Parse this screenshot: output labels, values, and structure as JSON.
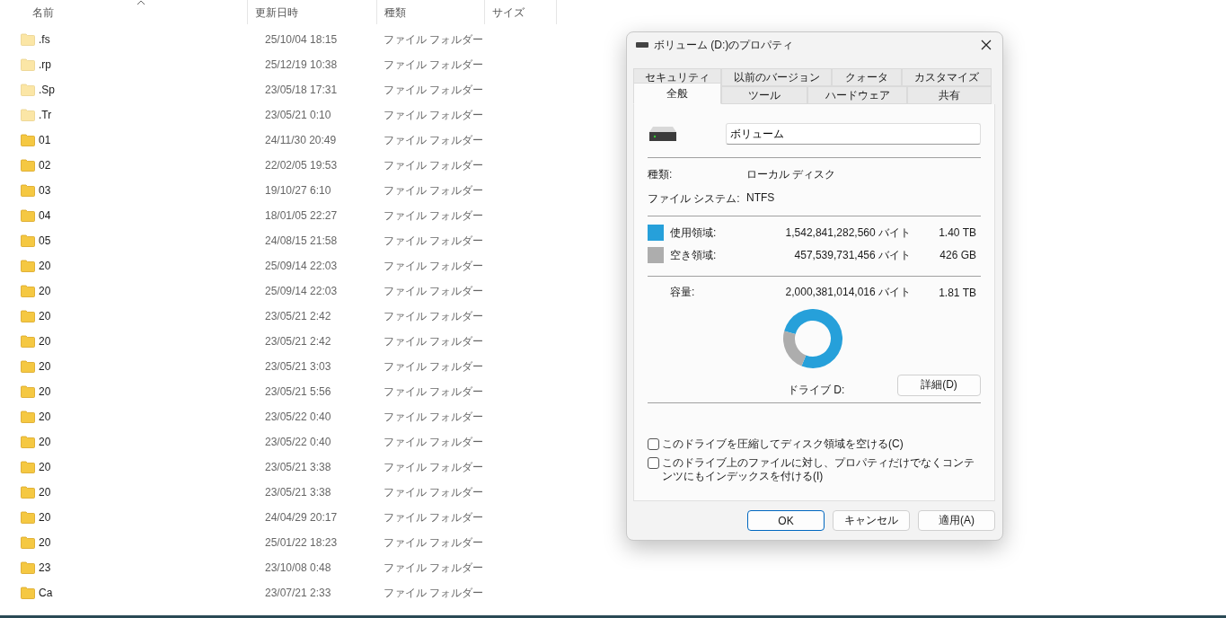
{
  "columns": [
    {
      "label": "名前",
      "sorted": true
    },
    {
      "label": "更新日時",
      "sorted": false
    },
    {
      "label": "種類",
      "sorted": false
    },
    {
      "label": "サイズ",
      "sorted": false
    }
  ],
  "files": [
    {
      "name": ".fs",
      "date": "25/10/04 18:15",
      "type": "ファイル フォルダー",
      "hidden": true
    },
    {
      "name": ".rp",
      "date": "25/12/19 10:38",
      "type": "ファイル フォルダー",
      "hidden": true
    },
    {
      "name": ".Sp",
      "date": "23/05/18 17:31",
      "type": "ファイル フォルダー",
      "hidden": true
    },
    {
      "name": ".Tr",
      "date": "23/05/21 0:10",
      "type": "ファイル フォルダー",
      "hidden": true
    },
    {
      "name": "01",
      "date": "24/11/30 20:49",
      "type": "ファイル フォルダー",
      "hidden": false
    },
    {
      "name": "02",
      "date": "22/02/05 19:53",
      "type": "ファイル フォルダー",
      "hidden": false
    },
    {
      "name": "03",
      "date": "19/10/27 6:10",
      "type": "ファイル フォルダー",
      "hidden": false
    },
    {
      "name": "04",
      "date": "18/01/05 22:27",
      "type": "ファイル フォルダー",
      "hidden": false
    },
    {
      "name": "05",
      "date": "24/08/15 21:58",
      "type": "ファイル フォルダー",
      "hidden": false
    },
    {
      "name": "20",
      "date": "25/09/14 22:03",
      "type": "ファイル フォルダー",
      "hidden": false
    },
    {
      "name": "20",
      "date": "25/09/14 22:03",
      "type": "ファイル フォルダー",
      "hidden": false
    },
    {
      "name": "20",
      "date": "23/05/21 2:42",
      "type": "ファイル フォルダー",
      "hidden": false
    },
    {
      "name": "20",
      "date": "23/05/21 2:42",
      "type": "ファイル フォルダー",
      "hidden": false
    },
    {
      "name": "20",
      "date": "23/05/21 3:03",
      "type": "ファイル フォルダー",
      "hidden": false
    },
    {
      "name": "20",
      "date": "23/05/21 5:56",
      "type": "ファイル フォルダー",
      "hidden": false
    },
    {
      "name": "20",
      "date": "23/05/22 0:40",
      "type": "ファイル フォルダー",
      "hidden": false
    },
    {
      "name": "20",
      "date": "23/05/22 0:40",
      "type": "ファイル フォルダー",
      "hidden": false
    },
    {
      "name": "20",
      "date": "23/05/21 3:38",
      "type": "ファイル フォルダー",
      "hidden": false
    },
    {
      "name": "20",
      "date": "23/05/21 3:38",
      "type": "ファイル フォルダー",
      "hidden": false
    },
    {
      "name": "20",
      "date": "24/04/29 20:17",
      "type": "ファイル フォルダー",
      "hidden": false
    },
    {
      "name": "20",
      "date": "25/01/22 18:23",
      "type": "ファイル フォルダー",
      "hidden": false
    },
    {
      "name": "23",
      "date": "23/10/08 0:48",
      "type": "ファイル フォルダー",
      "hidden": false
    },
    {
      "name": "Ca",
      "date": "23/07/21 2:33",
      "type": "ファイル フォルダー",
      "hidden": false
    }
  ],
  "dialog": {
    "title": "ボリューム (D:)のプロパティ",
    "tab_rows": [
      [
        {
          "label": "セキュリティ",
          "selected": false
        },
        {
          "label": "以前のバージョン",
          "selected": false
        },
        {
          "label": "クォータ",
          "selected": false
        },
        {
          "label": "カスタマイズ",
          "selected": false
        }
      ],
      [
        {
          "label": "全般",
          "selected": true
        },
        {
          "label": "ツール",
          "selected": false
        },
        {
          "label": "ハードウェア",
          "selected": false
        },
        {
          "label": "共有",
          "selected": false
        }
      ]
    ],
    "volume_name": "ボリューム",
    "info": [
      {
        "label": "種類:",
        "value": "ローカル ディスク"
      },
      {
        "label": "ファイル システム:",
        "value": "NTFS"
      }
    ],
    "space": [
      {
        "label": "使用領域:",
        "bytes": "1,542,841,282,560 バイト",
        "size": "1.40 TB",
        "color": "#26a0da"
      },
      {
        "label": "空き領域:",
        "bytes": "457,539,731,456 バイト",
        "size": "426 GB",
        "color": "#adadad"
      }
    ],
    "capacity": {
      "label": "容量:",
      "bytes": "2,000,381,014,016 バイト",
      "size": "1.81 TB"
    },
    "chart_data": {
      "type": "donut",
      "values": [
        77.13,
        22.87
      ]
    },
    "drive_label": "ドライブ D:",
    "details_button": "詳細(D)",
    "options": [
      {
        "label": "このドライブを圧縮してディスク領域を空ける(C)",
        "checked": false
      },
      {
        "label": "このドライブ上のファイルに対し、プロパティだけでなくコンテンツにもインデックスを付ける(I)",
        "checked": false
      }
    ],
    "buttons": [
      {
        "label": "OK",
        "default": true
      },
      {
        "label": "キャンセル",
        "default": false
      },
      {
        "label": "適用(A)",
        "default": false
      }
    ]
  }
}
